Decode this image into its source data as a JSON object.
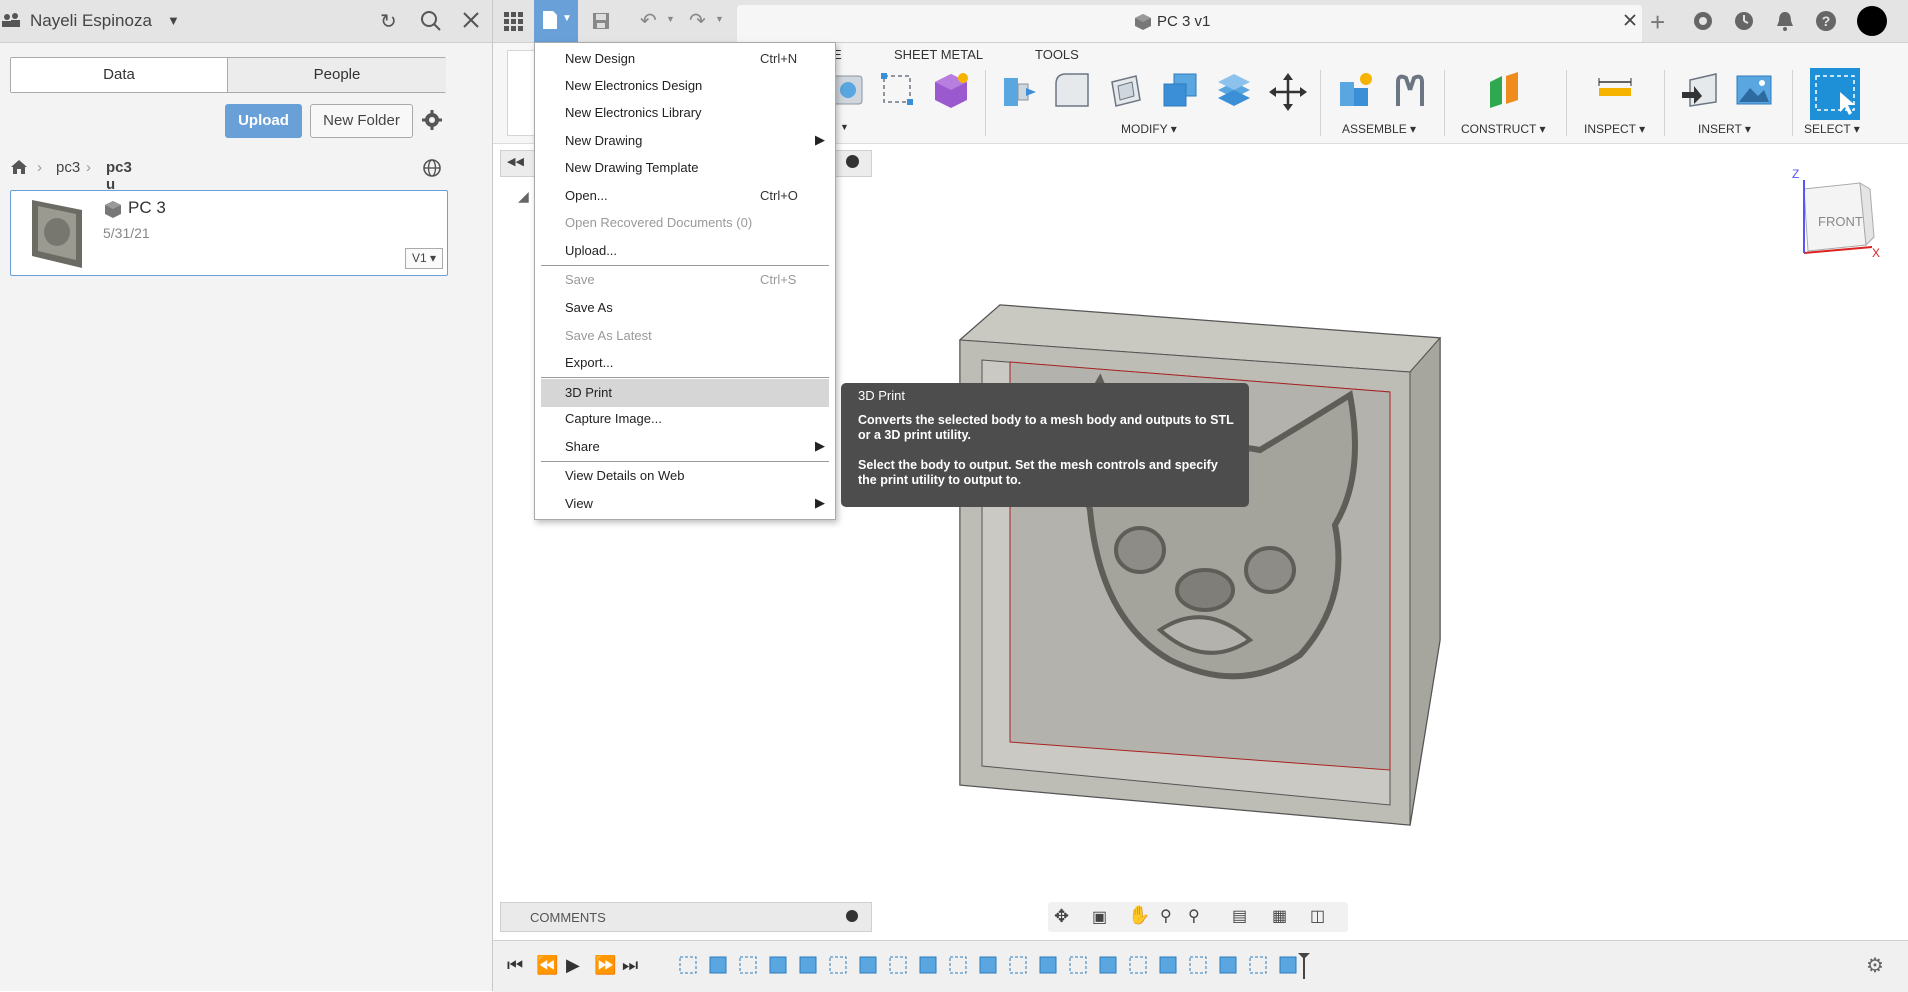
{
  "left_panel": {
    "user_name": "Nayeli Espinoza",
    "tabs": [
      "Data",
      "People"
    ],
    "upload_label": "Upload",
    "new_folder_label": "New Folder",
    "breadcrumb": [
      "pc3",
      "pc3 u"
    ],
    "file": {
      "name": "PC 3",
      "date": "5/31/21",
      "version": "V1"
    }
  },
  "document": {
    "title": "PC 3 v1"
  },
  "toolbar": {
    "tabs": [
      "SHEET METAL",
      "TOOLS"
    ],
    "groups": [
      "MODIFY",
      "ASSEMBLE",
      "CONSTRUCT",
      "INSPECT",
      "INSERT",
      "SELECT"
    ]
  },
  "file_menu": {
    "items": [
      {
        "label": "New Design",
        "shortcut": "Ctrl+N"
      },
      {
        "label": "New Electronics Design"
      },
      {
        "label": "New Electronics Library"
      },
      {
        "label": "New Drawing"
      },
      {
        "label": "New Drawing Template"
      },
      {
        "label": "Open...",
        "shortcut": "Ctrl+O"
      },
      {
        "label": "Open Recovered Documents (0)"
      },
      {
        "label": "Upload..."
      },
      {
        "label": "Save",
        "shortcut": "Ctrl+S"
      },
      {
        "label": "Save As"
      },
      {
        "label": "Save As Latest"
      },
      {
        "label": "Export..."
      },
      {
        "label": "3D Print"
      },
      {
        "label": "Capture Image..."
      },
      {
        "label": "Share"
      },
      {
        "label": "View Details on Web"
      },
      {
        "label": "View"
      }
    ]
  },
  "tooltip": {
    "title": "3D Print",
    "line1": "Converts the selected body to a mesh body and outputs to STL or a 3D print utility.",
    "line2": "Select the body to output. Set the mesh controls and specify the print utility to output to."
  },
  "canvas": {
    "comments_label": "COMMENTS",
    "viewcube_face": "FRONT",
    "axis_z": "Z",
    "axis_x": "X"
  },
  "colors": {
    "accent": "#6aa0d8",
    "select_blue": "#1e90d8",
    "tooltip_bg": "#4d4d4d"
  }
}
